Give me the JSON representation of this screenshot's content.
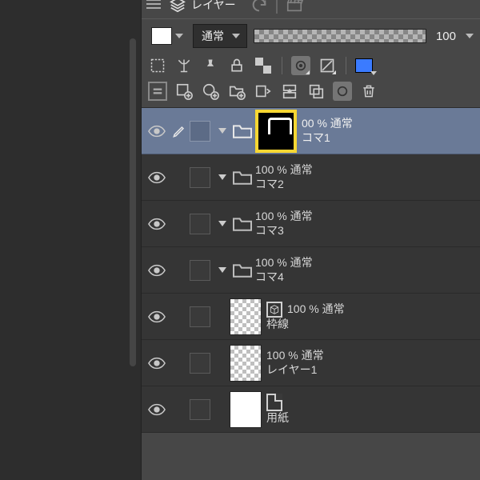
{
  "header": {
    "title": "レイヤー"
  },
  "blend": {
    "mode": "通常",
    "opacity": "100"
  },
  "icons": {
    "undo": "↶",
    "clapper": "🎬"
  },
  "layers": [
    {
      "folder": true,
      "meta": "00 % 通常",
      "name": "コマ1",
      "sel": true,
      "bigthumb": true,
      "indent": 0,
      "pen": true
    },
    {
      "folder": true,
      "meta": "100 % 通常",
      "name": "コマ2",
      "sel": false,
      "indent": 0
    },
    {
      "folder": true,
      "meta": "100 % 通常",
      "name": "コマ3",
      "sel": false,
      "indent": 0
    },
    {
      "folder": true,
      "meta": "100 % 通常",
      "name": "コマ4",
      "sel": false,
      "indent": 0
    },
    {
      "folder": false,
      "meta": "100 % 通常",
      "name": "枠線",
      "sel": false,
      "cube": true,
      "thumb": "checker",
      "indent": 0
    },
    {
      "folder": false,
      "meta": "100 % 通常",
      "name": "レイヤー1",
      "sel": false,
      "thumb": "checker",
      "indent": 0
    },
    {
      "folder": false,
      "meta": "",
      "name": "用紙",
      "sel": false,
      "thumb": "white",
      "pagebadge": true,
      "indent": 0
    }
  ]
}
